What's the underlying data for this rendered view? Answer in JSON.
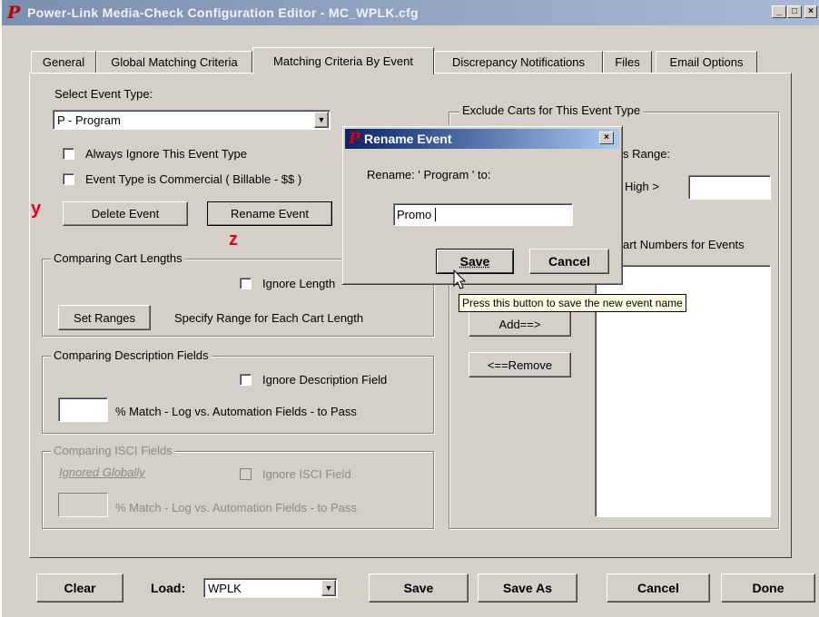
{
  "window": {
    "title": "Power-Link Media-Check Configuration Editor  -  MC_WPLK.cfg",
    "logo_letter": "P",
    "minimize_glyph": "_",
    "maximize_glyph": "□",
    "close_glyph": "×"
  },
  "tabs": [
    {
      "label": "General"
    },
    {
      "label": "Global Matching Criteria"
    },
    {
      "label": "Matching Criteria By Event"
    },
    {
      "label": "Discrepancy Notifications"
    },
    {
      "label": "Files"
    },
    {
      "label": "Email Options"
    }
  ],
  "active_tab": "Matching Criteria By Event",
  "event": {
    "select_label": "Select Event Type:",
    "selected_value": "P - Program",
    "always_ignore_label": "Always Ignore This Event Type",
    "commercial_label": "Event Type is Commercial ( Billable - $$ )",
    "delete_button": "Delete Event",
    "rename_button": "Rename Event"
  },
  "annotations": {
    "y": "y",
    "z": "z"
  },
  "cart_lengths": {
    "group_label": "Comparing Cart Lengths",
    "ignore_label": "Ignore Length",
    "set_ranges_button": "Set Ranges",
    "specify_text": "Specify Range for Each Cart Length"
  },
  "description": {
    "group_label": "Comparing Description Fields",
    "ignore_label": "Ignore  Description Field",
    "percent_value": "",
    "match_text": "% Match - Log vs. Automation Fields - to Pass"
  },
  "isci": {
    "group_label": "Comparing ISCI Fields",
    "ignored_globally": "Ignored Globally",
    "ignore_label": "Ignore ISCI Field",
    "percent_value": "",
    "match_text": "% Match - Log vs. Automation Fields - to Pass"
  },
  "exclude": {
    "group_label": "Exclude Carts for This Event Type",
    "range_label": "s Range:",
    "high_label": "High >",
    "high_value": "",
    "cart_numbers_label": "art Numbers for Events",
    "add_button": "Add==>",
    "remove_button": "<==Remove"
  },
  "dialog": {
    "title": "Rename Event",
    "close_glyph": "×",
    "prompt": "Rename: ' Program ' to:",
    "input_value": "Promo",
    "save_button": "Save",
    "cancel_button": "Cancel",
    "tooltip": "Press this button to save the new event name"
  },
  "footer": {
    "clear_button": "Clear",
    "load_label": "Load:",
    "load_value": "WPLK",
    "save_button": "Save",
    "save_as_button": "Save As",
    "cancel_button": "Cancel",
    "done_button": "Done"
  },
  "colors": {
    "window_bg": "#d4d0c8",
    "title_inactive": "#7b8fae",
    "title_active": "#0a246a",
    "annotation_red": "#e8001c",
    "logo_red": "#c00000",
    "tooltip_bg": "#ffffe1"
  }
}
